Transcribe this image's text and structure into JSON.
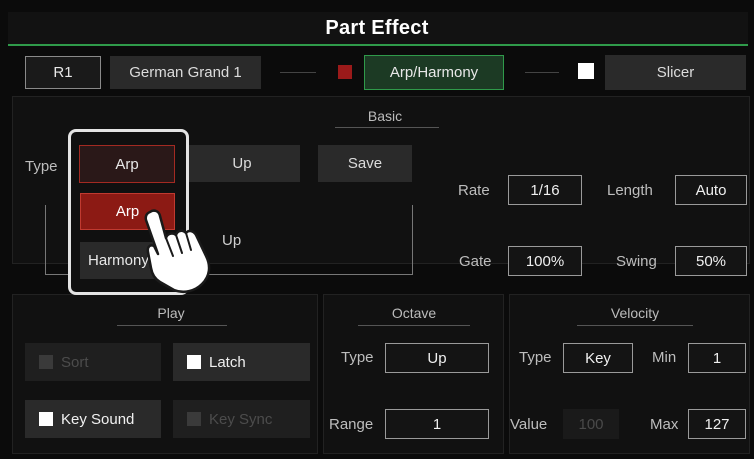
{
  "title": "Part Effect",
  "top_row": {
    "part": "R1",
    "voice": "German Grand 1",
    "arp_harmony": "Arp/Harmony",
    "slicer": "Slicer"
  },
  "basic": {
    "section_label": "Basic",
    "type_label": "Type",
    "type_value": "Arp",
    "mode_value": "Up",
    "save_label": "Save",
    "rate_label": "Rate",
    "rate_value": "1/16",
    "length_label": "Length",
    "length_value": "Auto",
    "gate_label": "Gate",
    "gate_value": "100%",
    "swing_label": "Swing",
    "swing_value": "50%",
    "bg_mode": "Up"
  },
  "type_popup": {
    "options": [
      "Arp",
      "Harmony"
    ],
    "selected": "Arp"
  },
  "play": {
    "section_label": "Play",
    "sort": "Sort",
    "latch": "Latch",
    "key_sound": "Key Sound",
    "key_sync": "Key Sync"
  },
  "octave": {
    "section_label": "Octave",
    "type_label": "Type",
    "type_value": "Up",
    "range_label": "Range",
    "range_value": "1"
  },
  "velocity": {
    "section_label": "Velocity",
    "type_label": "Type",
    "type_value": "Key",
    "min_label": "Min",
    "min_value": "1",
    "value_label": "Value",
    "value_value": "100",
    "max_label": "Max",
    "max_value": "127"
  },
  "colors": {
    "accent_green": "#2f9a4a",
    "accent_red": "#8c1a14"
  },
  "icons": {
    "hand": "pointing-hand-icon"
  }
}
